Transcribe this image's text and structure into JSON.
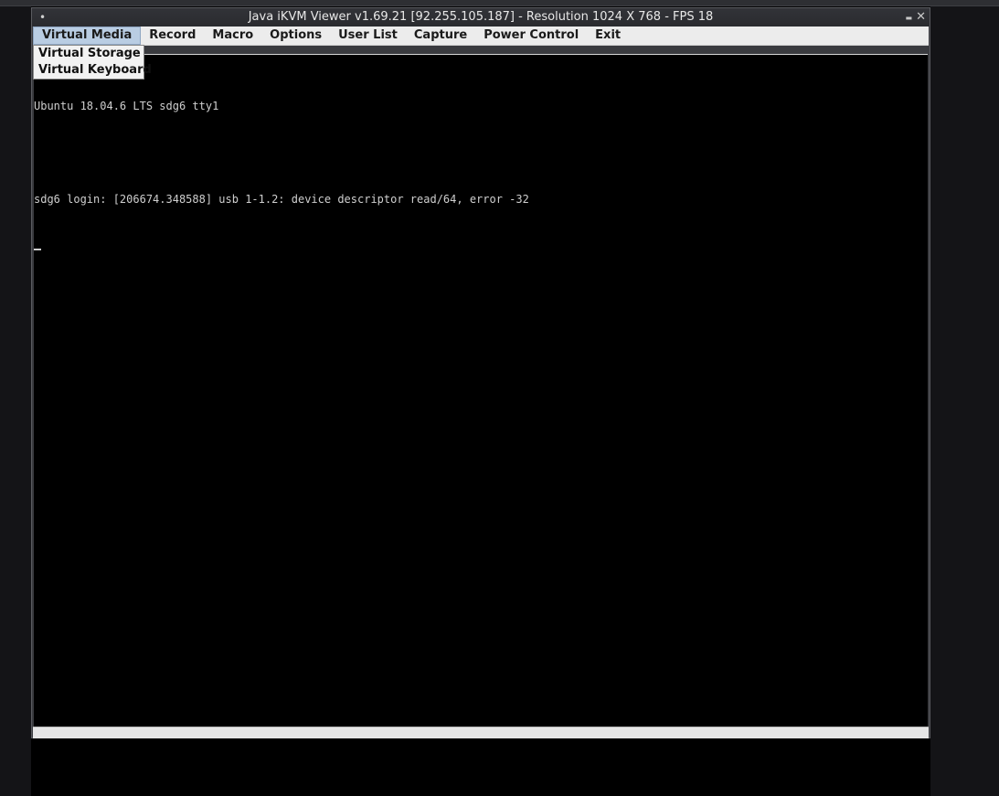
{
  "window": {
    "title": "Java iKVM Viewer v1.69.21 [92.255.105.187]  - Resolution 1024 X 768 - FPS 18",
    "title_dot": "•",
    "minimize_glyph": "▬",
    "close_glyph": "✕"
  },
  "menubar": {
    "items": [
      {
        "label": "Virtual Media",
        "active": true
      },
      {
        "label": "Record"
      },
      {
        "label": "Macro"
      },
      {
        "label": "Options"
      },
      {
        "label": "User List"
      },
      {
        "label": "Capture"
      },
      {
        "label": "Power Control"
      },
      {
        "label": "Exit"
      }
    ]
  },
  "dropdown": {
    "items": [
      {
        "label": "Virtual Storage"
      },
      {
        "label": "Virtual Keyboard"
      }
    ]
  },
  "console": {
    "line1": "Ubuntu 18.04.6 LTS sdg6 tty1",
    "line2": "sdg6 login: [206674.348588] usb 1-1.2: device descriptor read/64, error -32"
  },
  "colors": {
    "menu_active_bg": "#b9cde3",
    "console_bg": "#000000",
    "console_fg": "#cfcfcf"
  }
}
